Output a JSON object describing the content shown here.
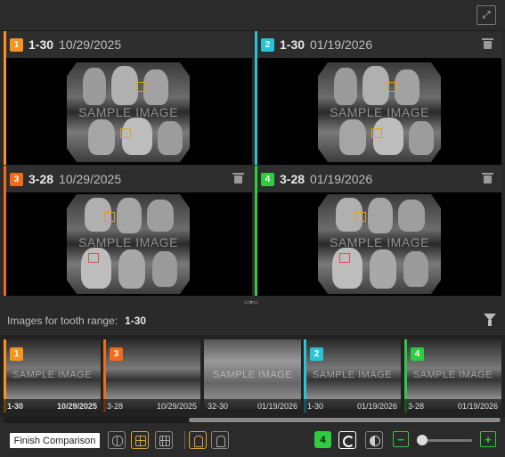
{
  "panels": [
    {
      "badge": "1",
      "tooth": "1-30",
      "date": "10/29/2025",
      "color": "#f7931e",
      "watermark": "SAMPLE IMAGE"
    },
    {
      "badge": "2",
      "tooth": "1-30",
      "date": "01/19/2026",
      "color": "#29c4d6",
      "watermark": "SAMPLE IMAGE"
    },
    {
      "badge": "3",
      "tooth": "3-28",
      "date": "10/29/2025",
      "color": "#f26a1b",
      "watermark": "SAMPLE IMAGE"
    },
    {
      "badge": "4",
      "tooth": "3-28",
      "date": "01/19/2026",
      "color": "#2ecc40",
      "watermark": "SAMPLE IMAGE"
    }
  ],
  "range": {
    "label": "Images for tooth range:",
    "value": "1-30"
  },
  "thumbnails": [
    {
      "badge": "1",
      "tooth": "1-30",
      "date": "10/29/2025",
      "color": "#f7931e",
      "watermark": "SAMPLE IMAGE"
    },
    {
      "badge": "3",
      "tooth": "3-28",
      "date": "10/29/2025",
      "color": "#f26a1b",
      "watermark": ""
    },
    {
      "badge": "",
      "tooth": "32-30",
      "date": "01/19/2026",
      "color": "",
      "watermark": "SAMPLE IMAGE"
    },
    {
      "badge": "2",
      "tooth": "1-30",
      "date": "01/19/2026",
      "color": "#29c4d6",
      "watermark": "SAMPLE IMAGE"
    },
    {
      "badge": "4",
      "tooth": "3-28",
      "date": "01/19/2026",
      "color": "#2ecc40",
      "watermark": "SAMPLE IMAGE"
    }
  ],
  "toolbar": {
    "finish_label": "Finish Comparison",
    "selected_count": "4"
  },
  "icons": {
    "expand": "expand-icon",
    "trash": "trash-icon",
    "filter": "filter-icon",
    "layout1": "layout-2-columns-icon",
    "layout2": "layout-2x2-icon",
    "layout3": "layout-grid-icon",
    "tooth1": "tooth-icon",
    "tooth2": "tooth-outline-icon",
    "sync": "sync-icon",
    "contrast": "contrast-icon"
  }
}
